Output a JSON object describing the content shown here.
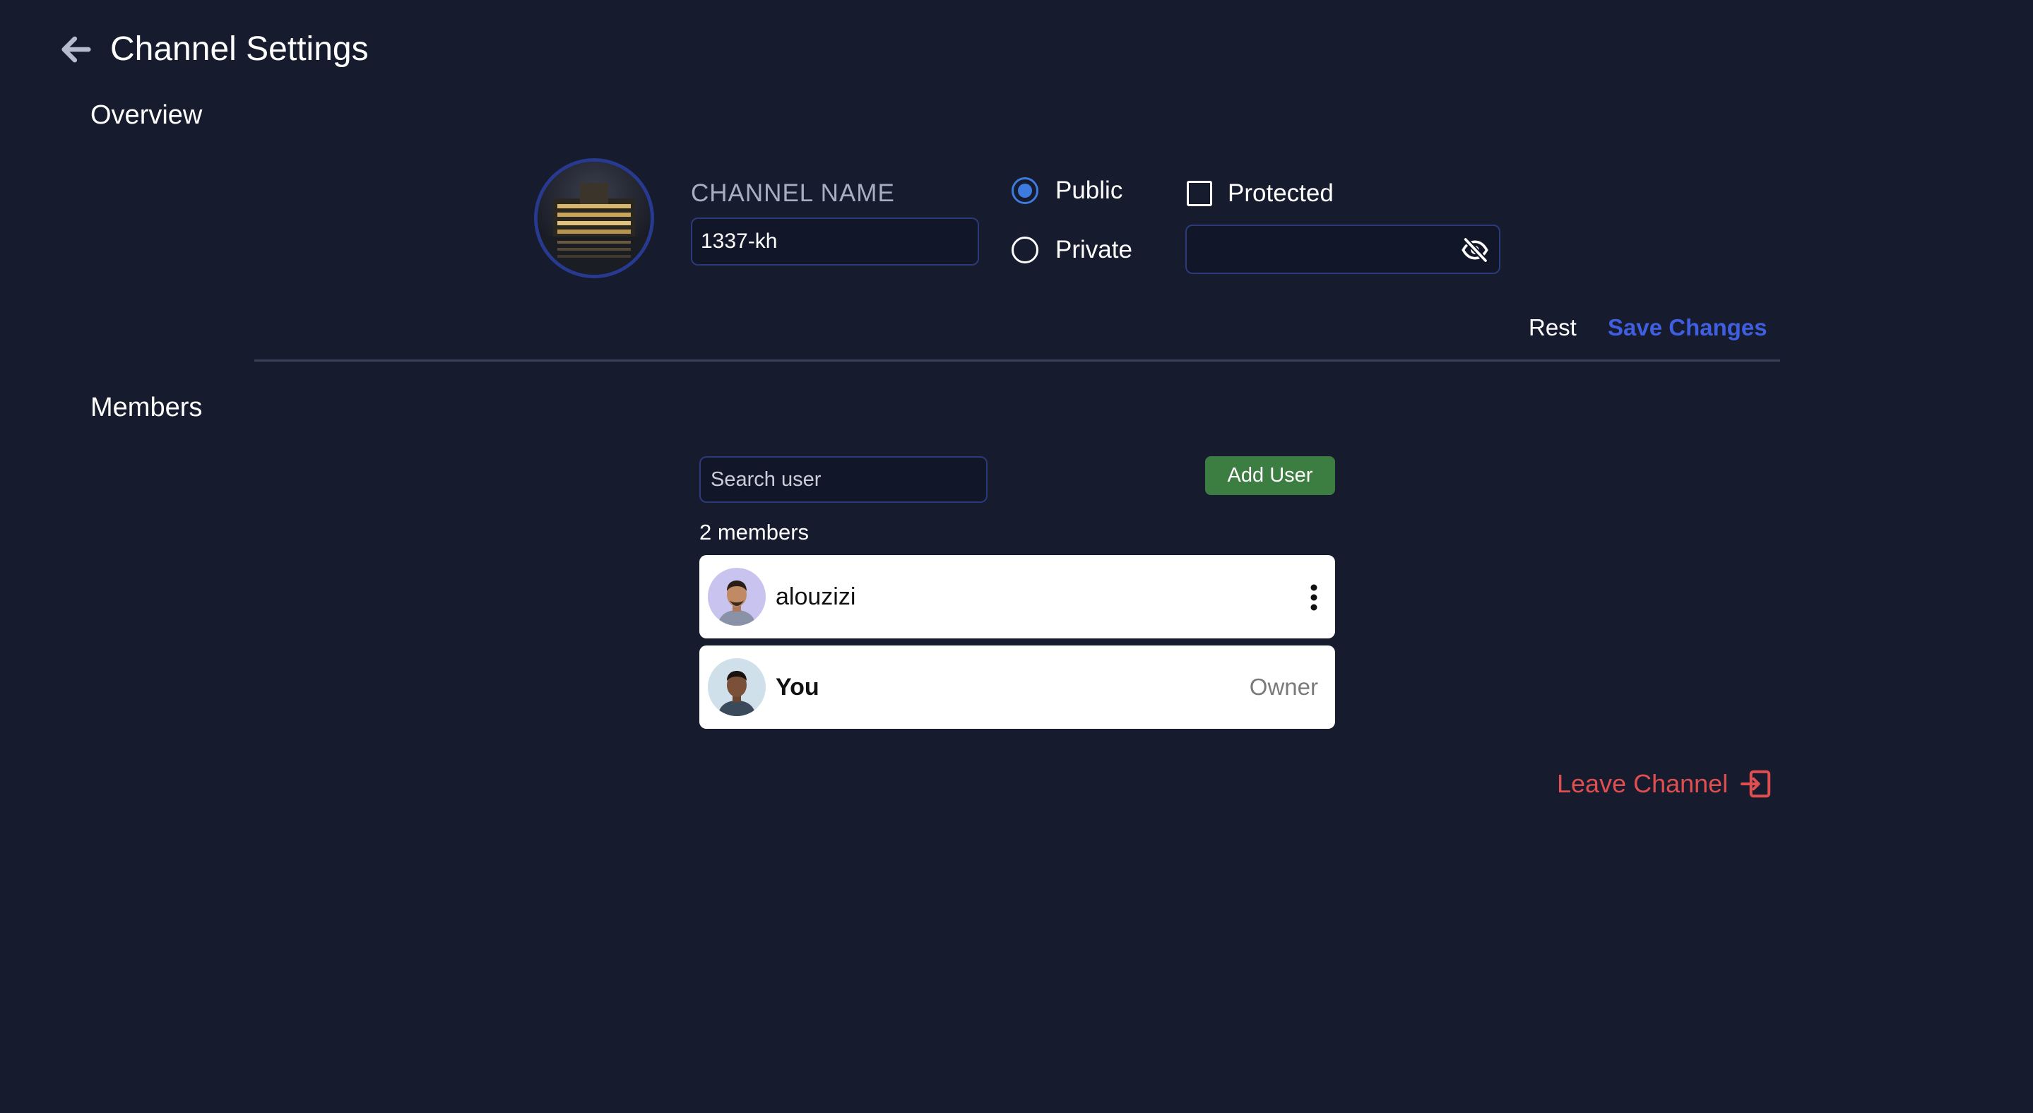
{
  "header": {
    "title": "Channel Settings"
  },
  "overview": {
    "title": "Overview",
    "channel_name_label": "CHANNEL NAME",
    "channel_name_value": "1337-kh",
    "visibility": {
      "public_label": "Public",
      "private_label": "Private",
      "selected": "public"
    },
    "protected": {
      "label": "Protected",
      "checked": false,
      "password_value": ""
    },
    "actions": {
      "rest_label": "Rest",
      "save_label": "Save Changes"
    }
  },
  "members": {
    "title": "Members",
    "search_placeholder": "Search user",
    "add_user_label": "Add User",
    "count_text": "2 members",
    "list": [
      {
        "name": "alouzizi",
        "role": ""
      },
      {
        "name": "You",
        "role": "Owner"
      }
    ]
  },
  "leave": {
    "label": "Leave Channel"
  },
  "colors": {
    "background": "#161b2e",
    "accent_blue": "#3f5fe0",
    "radio_blue": "#3d7be0",
    "add_green": "#3c7d42",
    "danger_red": "#e04f4f"
  },
  "icons": [
    "back-arrow-icon",
    "eye-off-icon",
    "kebab-menu-icon",
    "exit-icon"
  ]
}
